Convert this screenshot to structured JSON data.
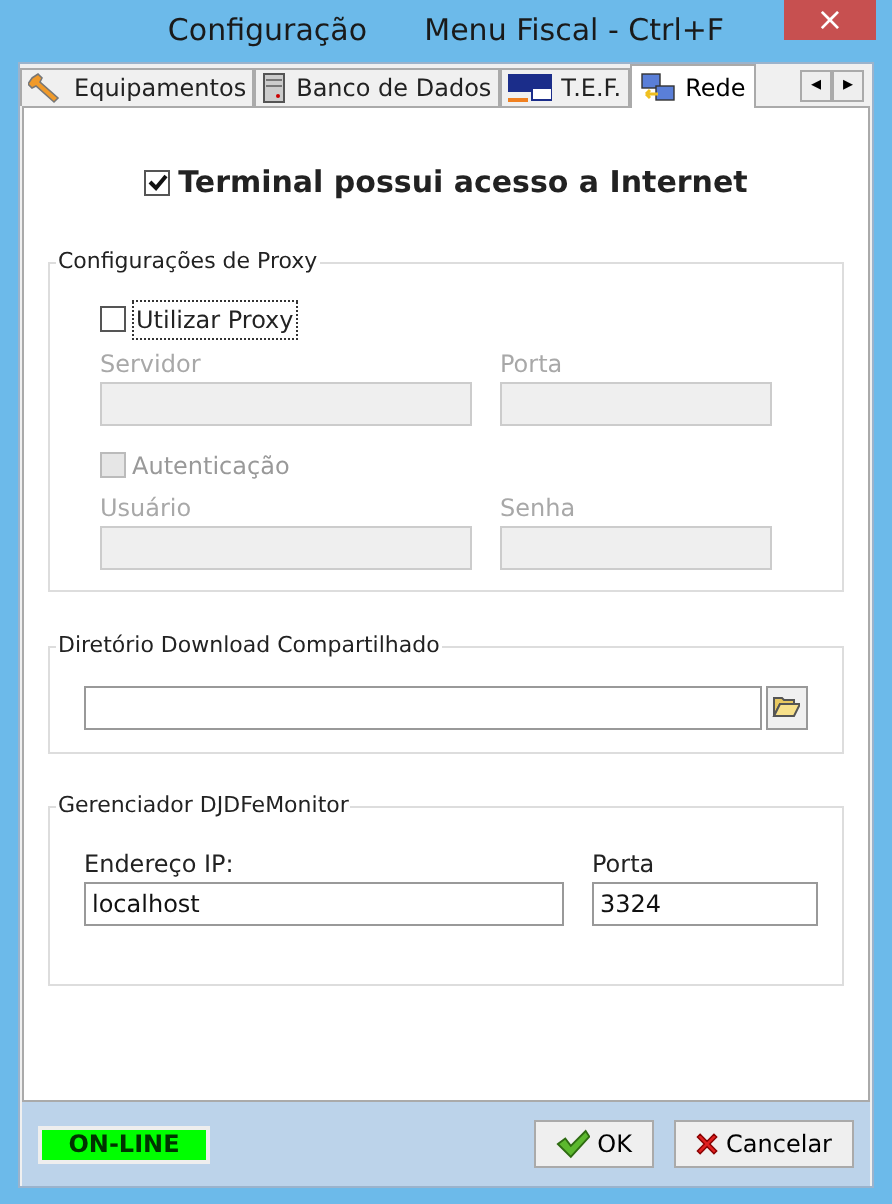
{
  "window": {
    "title": "Configuração      Menu Fiscal - Ctrl+F",
    "close": "×"
  },
  "tabs": [
    {
      "label": "Equipamentos",
      "kind": "wrench",
      "selected": false
    },
    {
      "label": "Banco de Dados",
      "kind": "server",
      "selected": false
    },
    {
      "label": "T.E.F.",
      "kind": "card",
      "selected": false
    },
    {
      "label": "Rede",
      "kind": "network",
      "selected": true
    }
  ],
  "tab_scroll": [
    "◂",
    "▸"
  ],
  "internet": {
    "label": "Terminal possui acesso a Internet",
    "checked": true
  },
  "proxy": {
    "title": "Configurações de Proxy",
    "use_proxy": {
      "label": "Utilizar Proxy",
      "checked": false,
      "disabled": false
    },
    "fields_row_1": [
      {
        "label": "Servidor",
        "disabled": true
      },
      {
        "label": "Porta",
        "disabled": true
      }
    ],
    "auth": {
      "label": "Autenticação",
      "checked": false,
      "disabled": true
    },
    "fields_row_2": [
      {
        "label": "Usuário",
        "disabled": true
      },
      {
        "label": "Senha",
        "disabled": true
      }
    ]
  },
  "shared_dir": {
    "title": "Diretório Download Compartilhado"
  },
  "monitor": {
    "title": "Gerenciador DJDFeMonitor",
    "fields": [
      {
        "label": "Endereço IP:",
        "value": "localhost"
      },
      {
        "label": "Porta",
        "value": "3324"
      }
    ]
  },
  "status": {
    "label": "ON-LINE",
    "online": true
  },
  "buttons": [
    {
      "label": "OK",
      "kind": "ok"
    },
    {
      "label": "Cancelar",
      "kind": "cancel"
    }
  ]
}
